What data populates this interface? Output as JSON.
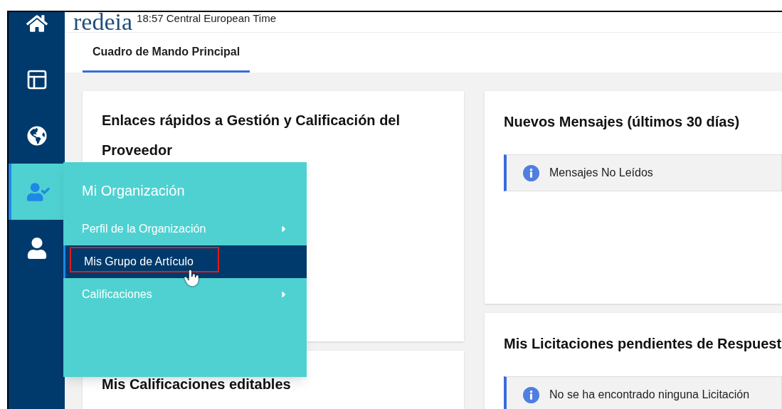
{
  "header": {
    "logo": "redeia",
    "time": "18:57 Central European Time"
  },
  "sidebar": {
    "items": [
      {
        "kind": "home",
        "selected": false
      },
      {
        "kind": "layout",
        "selected": false
      },
      {
        "kind": "globe",
        "selected": false
      },
      {
        "kind": "organization",
        "selected": true
      },
      {
        "kind": "user",
        "selected": false
      }
    ]
  },
  "tabs": [
    {
      "label": "Cuadro de Mando Principal",
      "selected": true
    }
  ],
  "left_cards": [
    {
      "title": "Enlaces rápidos a Gestión y Calificación del Proveedor"
    },
    {
      "title": "Mis Calificaciones editables"
    }
  ],
  "right_cards": [
    {
      "title": "Nuevos Mensajes (últimos 30 días)",
      "notice": "Mensajes No Leídos"
    },
    {
      "title": "Mis Licitaciones pendientes de Respuest",
      "notice": "No se ha encontrado ninguna Licitación"
    }
  ],
  "flyout": {
    "title": "Mi Organización",
    "items": [
      {
        "label": "Perfil de la Organización",
        "has_submenu": true,
        "selected": false,
        "outlined": false
      },
      {
        "label": "Mis Grupo de Artículo",
        "has_submenu": false,
        "selected": true,
        "outlined": true
      },
      {
        "label": "Calificaciones",
        "has_submenu": true,
        "selected": false,
        "outlined": false
      }
    ]
  }
}
